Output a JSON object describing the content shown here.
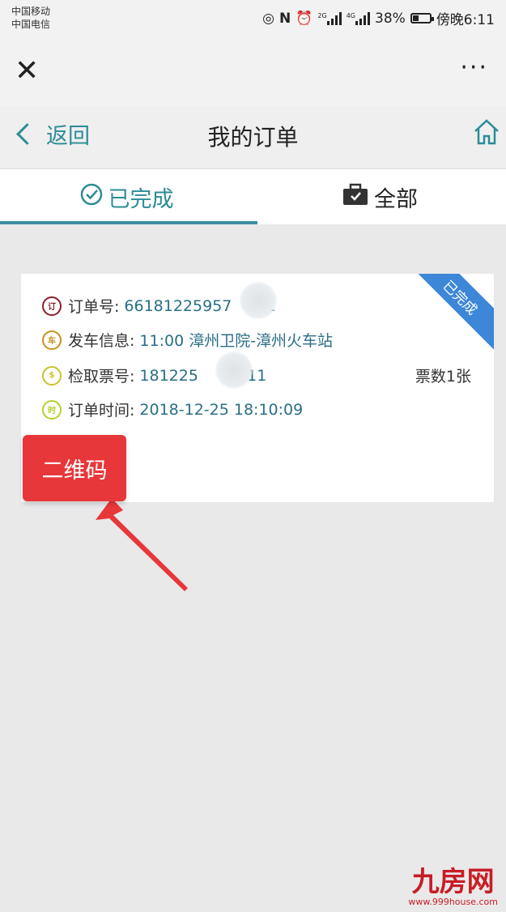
{
  "status_bar": {
    "carrier_1": "中国移动",
    "carrier_2": "中国电信",
    "signal_label_1": "2G",
    "signal_label_2": "4G",
    "battery": "38%",
    "battery_level": 0.38,
    "time": "傍晚6:11"
  },
  "topbar": {
    "close_icon": "✕",
    "more_icon": "···"
  },
  "nav": {
    "back_label": "返回",
    "title": "我的订单"
  },
  "tabs": [
    {
      "label": "已完成",
      "active": true,
      "icon": "check-circle-icon"
    },
    {
      "label": "全部",
      "active": false,
      "icon": "briefcase-icon"
    }
  ],
  "order": {
    "ribbon": "已完成",
    "rows": [
      {
        "icon_text": "订",
        "label": "订单号:",
        "value": "66181225957",
        "value_tail": "41",
        "icon_color": "#8a1f2a"
      },
      {
        "icon_text": "车",
        "label": "发车信息:",
        "value": "11:00 漳州卫院-漳州火车站",
        "icon_color": "#c7921c"
      },
      {
        "icon_text": "$",
        "label": "检取票号:",
        "value": "181225",
        "value_tail": "8111",
        "icon_color": "#c9c229"
      },
      {
        "icon_text": "时",
        "label": "订单时间:",
        "value": "2018-12-25 18:10:09",
        "icon_color": "#b8d12c"
      }
    ],
    "ticket_count": "票数1张"
  },
  "annotation": {
    "label": "二维码"
  },
  "watermark": {
    "logo": "九房网",
    "url": "www.999house.com"
  },
  "colors": {
    "accent": "#2c8c95",
    "value_text": "#2a6f86",
    "ribbon": "#3d86d8",
    "callout": "#e8373a"
  }
}
